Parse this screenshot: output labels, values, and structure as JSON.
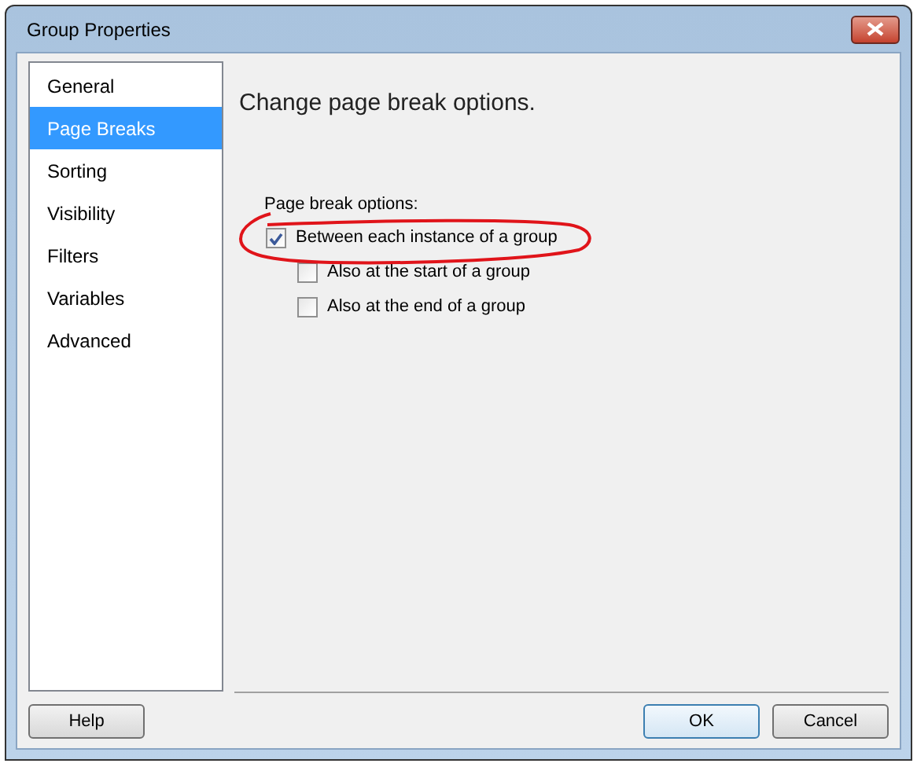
{
  "window": {
    "title": "Group Properties"
  },
  "sidebar": {
    "items": [
      {
        "label": "General",
        "selected": false
      },
      {
        "label": "Page Breaks",
        "selected": true
      },
      {
        "label": "Sorting",
        "selected": false
      },
      {
        "label": "Visibility",
        "selected": false
      },
      {
        "label": "Filters",
        "selected": false
      },
      {
        "label": "Variables",
        "selected": false
      },
      {
        "label": "Advanced",
        "selected": false
      }
    ]
  },
  "heading": "Change page break options.",
  "group_label": "Page break options:",
  "options": [
    {
      "label": "Between each instance of a group",
      "checked": true,
      "indented": false
    },
    {
      "label": "Also at the start of a group",
      "checked": false,
      "indented": true
    },
    {
      "label": "Also at the end of a group",
      "checked": false,
      "indented": true
    }
  ],
  "buttons": {
    "help": "Help",
    "ok": "OK",
    "cancel": "Cancel"
  }
}
